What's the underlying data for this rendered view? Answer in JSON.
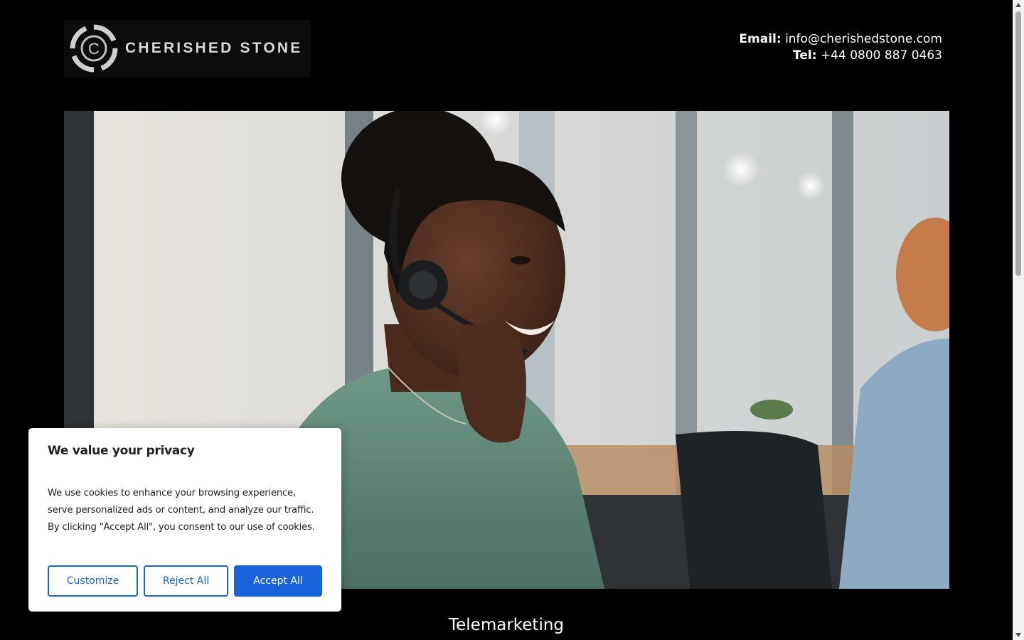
{
  "header": {
    "logo_text": "CHERISHED STONE",
    "email_label": "Email:",
    "email_value": "info@cherishedstone.com",
    "tel_label": "Tel:",
    "tel_value": "+44 0800 887 0463"
  },
  "hero": {
    "image_icon": "call-center-agent-photo",
    "caption": "Telemarketing"
  },
  "cookie_banner": {
    "title": "We value your privacy",
    "text": "We use cookies to enhance your browsing experience, serve personalized ads or content, and analyze our traffic. By clicking \"Accept All\", you consent to our use of cookies.",
    "customize_label": "Customize",
    "reject_label": "Reject All",
    "accept_label": "Accept All"
  },
  "colors": {
    "background": "#000000",
    "accent": "#1863dc",
    "dialog_bg": "#ffffff"
  }
}
